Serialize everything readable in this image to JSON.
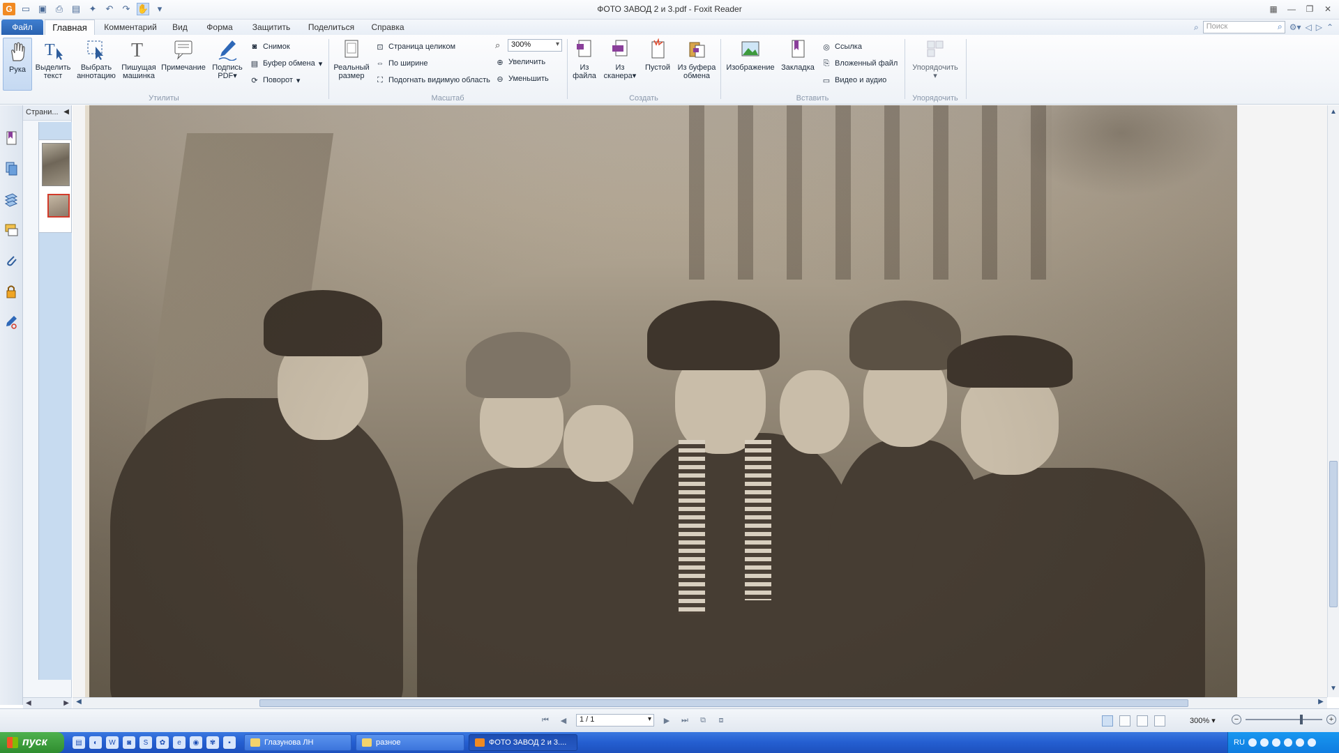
{
  "window": {
    "title": "ФОТО ЗАВОД 2 и 3.pdf - Foxit Reader"
  },
  "tabs": {
    "file": "Файл",
    "home": "Главная",
    "comment": "Комментарий",
    "view": "Вид",
    "form": "Форма",
    "protect": "Защитить",
    "share": "Поделиться",
    "help": "Справка"
  },
  "search": {
    "placeholder": "Поиск"
  },
  "ribbon": {
    "utilities": {
      "label": "Утилиты",
      "hand": "Рука",
      "select_text_1": "Выделить",
      "select_text_2": "текст",
      "select_annot_1": "Выбрать",
      "select_annot_2": "аннотацию",
      "typewriter_1": "Пишущая",
      "typewriter_2": "машинка",
      "note": "Примечание",
      "sign_1": "Подпись",
      "sign_2": "PDF",
      "snapshot": "Снимок",
      "clipboard": "Буфер обмена",
      "rotate": "Поворот"
    },
    "zoom": {
      "label": "Масштаб",
      "actual_1": "Реальный",
      "actual_2": "размер",
      "fit_page": "Страница целиком",
      "fit_width": "По ширине",
      "fit_visible": "Подогнать видимую область",
      "zoom_value": "300%",
      "zoom_in": "Увеличить",
      "zoom_out": "Уменьшить"
    },
    "create": {
      "label": "Создать",
      "from_file_1": "Из",
      "from_file_2": "файла",
      "from_scanner_1": "Из",
      "from_scanner_2": "сканера",
      "blank": "Пустой",
      "from_clip_1": "Из буфера",
      "from_clip_2": "обмена"
    },
    "insert": {
      "label": "Вставить",
      "image": "Изображение",
      "bookmark": "Закладка",
      "link": "Ссылка",
      "attach": "Вложенный файл",
      "video": "Видео и аудио"
    },
    "arrange": {
      "label": "Упорядочить",
      "btn": "Упорядочить"
    }
  },
  "panel": {
    "title": "Страни..."
  },
  "status": {
    "page": "1 / 1",
    "zoom": "300%"
  },
  "taskbar": {
    "start": "пуск",
    "task1": "Глазунова ЛН",
    "task2": "разное",
    "task3": "ФОТО ЗАВОД 2 и 3....",
    "lang": "RU"
  }
}
